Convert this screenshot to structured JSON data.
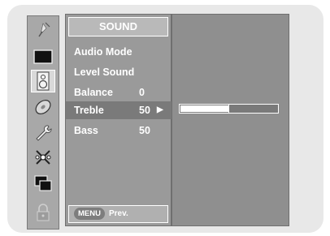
{
  "menu": {
    "title": "SOUND",
    "items": [
      {
        "label": "Audio Mode",
        "value": ""
      },
      {
        "label": "Level Sound",
        "value": ""
      },
      {
        "label": "Balance",
        "value": "0"
      },
      {
        "label": "Treble",
        "value": "50",
        "selected": true
      },
      {
        "label": "Bass",
        "value": "50"
      }
    ],
    "footer": {
      "button_label": "MENU",
      "label": "Prev."
    }
  },
  "treble_slider": {
    "value_fraction": 0.5
  },
  "sidebar": {
    "icons": [
      "antenna-icon",
      "picture-icon",
      "speaker-icon",
      "disc-icon",
      "wrench-icon",
      "option-icon",
      "pip-icon",
      "lock-icon"
    ],
    "selected": "speaker-icon"
  },
  "colors": {
    "menu_bg": "#9a9a9a",
    "panel_bg": "#8f8f8f",
    "selected_row": "#7a7a7a"
  }
}
